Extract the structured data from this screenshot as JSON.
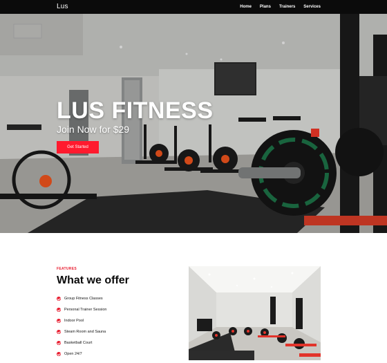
{
  "nav": {
    "brand": "Lus",
    "links": [
      "Home",
      "Plans",
      "Trainers",
      "Services"
    ]
  },
  "hero": {
    "title": "LUS FITNESS",
    "subtitle": "Join Now for $29",
    "cta_label": "Get Started",
    "accent_color": "#ff1a2e"
  },
  "features": {
    "label": "FEATURES",
    "heading": "What we offer",
    "items": [
      "Group Fitness Classes",
      "Personal Trainer Session",
      "Indoor Pool",
      "Steam Room and Sauna",
      "Basketball Court",
      "Open 24/7"
    ],
    "icon": "check-circle-icon"
  }
}
